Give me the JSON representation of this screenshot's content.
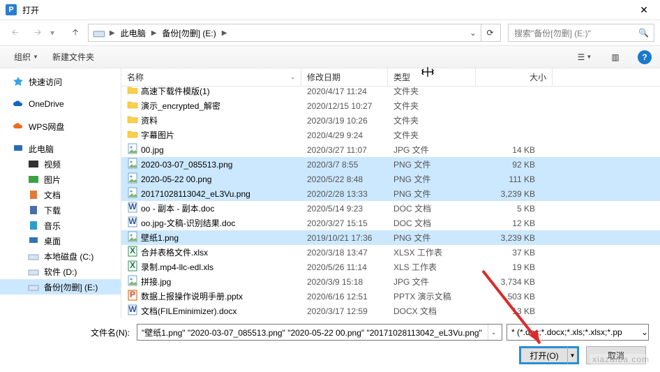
{
  "window": {
    "title": "打开"
  },
  "breadcrumb": {
    "items": [
      "此电脑",
      "备份[勿删] (E:)"
    ]
  },
  "search": {
    "placeholder": "搜索\"备份[勿删] (E:)\""
  },
  "toolbar": {
    "organize": "组织",
    "newfolder": "新建文件夹"
  },
  "sidebar": {
    "quick": "快速访问",
    "onedrive": "OneDrive",
    "wps": "WPS网盘",
    "thispc": "此电脑",
    "videos": "视频",
    "pictures": "图片",
    "documents": "文档",
    "downloads": "下载",
    "music": "音乐",
    "desktop": "桌面",
    "driveC": "本地磁盘 (C:)",
    "driveD": "软件 (D:)",
    "driveE": "备份[勿删] (E:)"
  },
  "columns": {
    "name": "名称",
    "date": "修改日期",
    "type": "类型",
    "size": "大小"
  },
  "files": [
    {
      "icon": "folder",
      "name": "高速下载件模版(1)",
      "date": "2020/4/17 11:24",
      "type": "文件夹",
      "size": "",
      "sel": false
    },
    {
      "icon": "folder",
      "name": "演示_encrypted_解密",
      "date": "2020/12/15 10:27",
      "type": "文件夹",
      "size": "",
      "sel": false
    },
    {
      "icon": "folder",
      "name": "资料",
      "date": "2020/3/19 10:26",
      "type": "文件夹",
      "size": "",
      "sel": false
    },
    {
      "icon": "folder",
      "name": "字幕图片",
      "date": "2020/4/29 9:24",
      "type": "文件夹",
      "size": "",
      "sel": false
    },
    {
      "icon": "img",
      "name": "00.jpg",
      "date": "2020/3/27 11:07",
      "type": "JPG 文件",
      "size": "14 KB",
      "sel": false
    },
    {
      "icon": "img",
      "name": "2020-03-07_085513.png",
      "date": "2020/3/7 8:55",
      "type": "PNG 文件",
      "size": "92 KB",
      "sel": true
    },
    {
      "icon": "img",
      "name": "2020-05-22 00.png",
      "date": "2020/5/22 8:48",
      "type": "PNG 文件",
      "size": "111 KB",
      "sel": true
    },
    {
      "icon": "img",
      "name": "20171028113042_eL3Vu.png",
      "date": "2020/2/28 13:33",
      "type": "PNG 文件",
      "size": "3,239 KB",
      "sel": true
    },
    {
      "icon": "doc",
      "name": "oo - 副本 - 副本.doc",
      "date": "2020/5/14 9:23",
      "type": "DOC 文档",
      "size": "5 KB",
      "sel": false
    },
    {
      "icon": "doc",
      "name": "oo.jpg-文稿-识别结果.doc",
      "date": "2020/3/27 15:15",
      "type": "DOC 文档",
      "size": "12 KB",
      "sel": false
    },
    {
      "icon": "img",
      "name": "壁纸1.png",
      "date": "2019/10/21 17:36",
      "type": "PNG 文件",
      "size": "3,239 KB",
      "sel": true
    },
    {
      "icon": "xls",
      "name": "合并表格文件.xlsx",
      "date": "2020/3/18 13:47",
      "type": "XLSX 工作表",
      "size": "37 KB",
      "sel": false
    },
    {
      "icon": "xls",
      "name": "录制.mp4-llc-edl.xls",
      "date": "2020/5/26 11:14",
      "type": "XLS 工作表",
      "size": "19 KB",
      "sel": false
    },
    {
      "icon": "img",
      "name": "拼接.jpg",
      "date": "2020/3/9 15:18",
      "type": "JPG 文件",
      "size": "3,734 KB",
      "sel": false
    },
    {
      "icon": "ppt",
      "name": "数据上报操作说明手册.pptx",
      "date": "2020/6/16 12:51",
      "type": "PPTX 演示文稿",
      "size": "503 KB",
      "sel": false
    },
    {
      "icon": "doc",
      "name": "文档(FILEminimizer).docx",
      "date": "2020/3/17 12:59",
      "type": "DOCX 文档",
      "size": "13 KB",
      "sel": false
    }
  ],
  "filename": {
    "label": "文件名(N):",
    "value": "\"壁纸1.png\" \"2020-03-07_085513.png\" \"2020-05-22 00.png\" \"20171028113042_eL3Vu.png\""
  },
  "filter": {
    "value": "* (*.doc;*.docx;*.xls;*.xlsx;*.pp"
  },
  "buttons": {
    "open": "打开(O)",
    "cancel": "取消"
  },
  "watermark": "xiazaiba.com"
}
